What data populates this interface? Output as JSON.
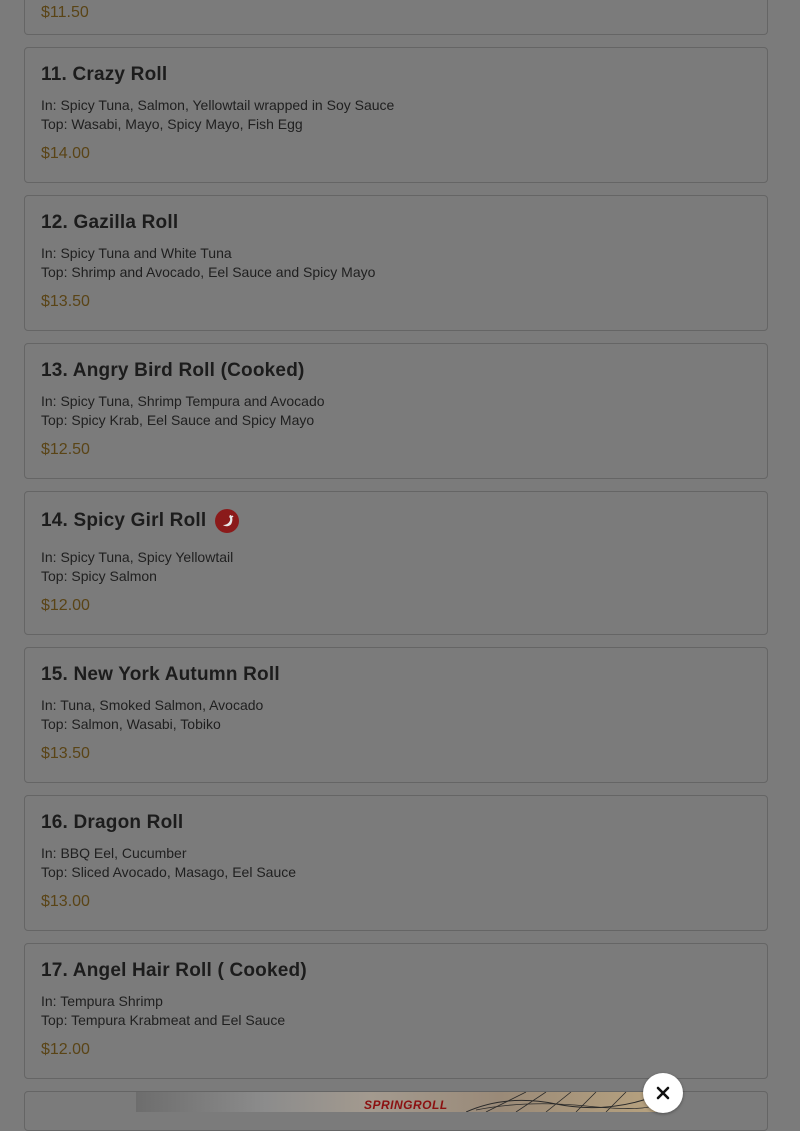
{
  "menu": {
    "previous_price": "$11.50",
    "items": [
      {
        "name": "11. Crazy Roll",
        "line1": "In: Spicy Tuna, Salmon, Yellowtail wrapped in Soy Sauce",
        "line2": "Top: Wasabi, Mayo, Spicy Mayo, Fish Egg",
        "price": "$14.00"
      },
      {
        "name": "12. Gazilla Roll",
        "line1": "In: Spicy Tuna and White Tuna",
        "line2": "Top: Shrimp and Avocado, Eel Sauce and Spicy Mayo",
        "price": "$13.50"
      },
      {
        "name": "13. Angry Bird Roll (Cooked)",
        "line1": "In: Spicy Tuna, Shrimp Tempura and Avocado",
        "line2": "Top: Spicy Krab, Eel Sauce and Spicy Mayo",
        "price": "$12.50"
      },
      {
        "name": "14. Spicy Girl Roll",
        "icon": "chili-pepper-icon",
        "line1": "In: Spicy Tuna, Spicy Yellowtail",
        "line2": "Top: Spicy Salmon",
        "price": "$12.00"
      },
      {
        "name": "15. New York Autumn Roll",
        "line1": "In: Tuna, Smoked Salmon, Avocado",
        "line2": "Top: Salmon, Wasabi, Tobiko",
        "price": "$13.50"
      },
      {
        "name": "16. Dragon Roll",
        "line1": "In: BBQ Eel, Cucumber",
        "line2": "Top: Sliced Avocado, Masago, Eel Sauce",
        "price": "$13.00"
      },
      {
        "name": "17. Angel Hair Roll ( Cooked)",
        "line1": "In: Tempura Shrimp",
        "line2": "Top: Tempura Krabmeat and Eel Sauce",
        "price": "$12.00"
      }
    ]
  },
  "promo": {
    "text": "SPRINGROLL",
    "close_icon": "close-icon"
  },
  "colors": {
    "overlay": "#7b7b7b",
    "price": "#5a4416",
    "spicy_badge": "#8b1a1a"
  }
}
